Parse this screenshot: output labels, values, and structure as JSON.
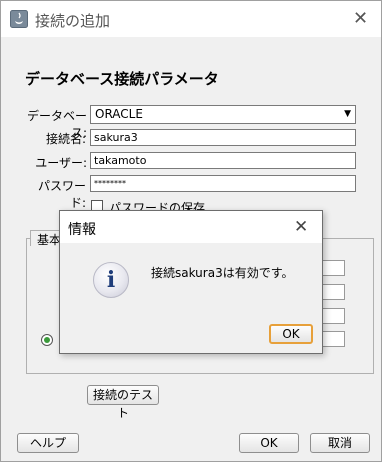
{
  "window": {
    "title": "接続の追加",
    "heading": "データベース接続パラメータ"
  },
  "form": {
    "database_label": "データベース:",
    "database_value": "ORACLE",
    "connection_label": "接続名:",
    "connection_value": "sakura3",
    "user_label": "ユーザー:",
    "user_value": "takamoto",
    "password_label": "パスワード:",
    "password_value": "********",
    "save_password_label": "パスワードの保存",
    "tab_basic": "基本"
  },
  "buttons": {
    "test_connection": "接続のテスト",
    "help": "ヘルプ",
    "ok": "OK",
    "cancel": "取消"
  },
  "message_dialog": {
    "title": "情報",
    "message": "接続sakura3は有効です。",
    "ok": "OK",
    "icon": "info-icon"
  }
}
